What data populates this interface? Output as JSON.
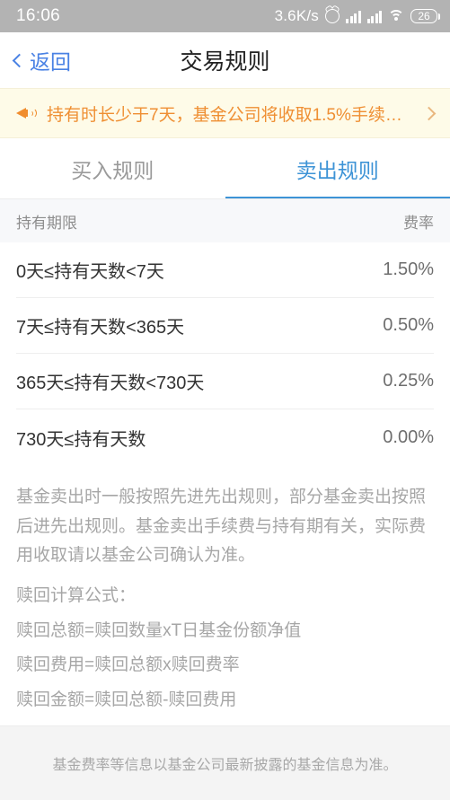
{
  "status_bar": {
    "time": "16:06",
    "network_speed": "3.6K/s",
    "alarm_icon": "alarm-clock-icon",
    "signal_icon_1": "cellular-signal-icon",
    "signal_icon_2": "cellular-signal-icon",
    "wifi_icon": "wifi-icon",
    "battery_level": "26"
  },
  "nav": {
    "back_label": "返回",
    "back_icon": "chevron-left-icon",
    "title": "交易规则",
    "back_color": "#4a82e4"
  },
  "banner": {
    "icon": "megaphone-icon",
    "text": "持有时长少于7天，基金公司将收取1.5%手续…",
    "arrow_icon": "chevron-right-icon",
    "background": "#fefbe8",
    "text_color": "#ef8f33"
  },
  "tabs": [
    {
      "label": "买入规则",
      "active": false
    },
    {
      "label": "卖出规则",
      "active": true
    }
  ],
  "tab_accent_color": "#3d93d6",
  "table": {
    "columns": [
      "持有期限",
      "费率"
    ],
    "rows": [
      {
        "term": "0天≤持有天数<7天",
        "rate": "1.50%"
      },
      {
        "term": "7天≤持有天数<365天",
        "rate": "0.50%"
      },
      {
        "term": "365天≤持有天数<730天",
        "rate": "0.25%"
      },
      {
        "term": "730天≤持有天数",
        "rate": "0.00%"
      }
    ]
  },
  "notes": {
    "paragraph": "基金卖出时一般按照先进先出规则，部分基金卖出按照后进先出规则。基金卖出手续费与持有期有关，实际费用收取请以基金公司确认为准。",
    "formula_title": "赎回计算公式：",
    "formula_lines": [
      "赎回总额=赎回数量xT日基金份额净值",
      "赎回费用=赎回总额x赎回费率",
      "赎回金额=赎回总额-赎回费用"
    ]
  },
  "footer": {
    "disclaimer": "基金费率等信息以基金公司最新披露的基金信息为准。"
  }
}
